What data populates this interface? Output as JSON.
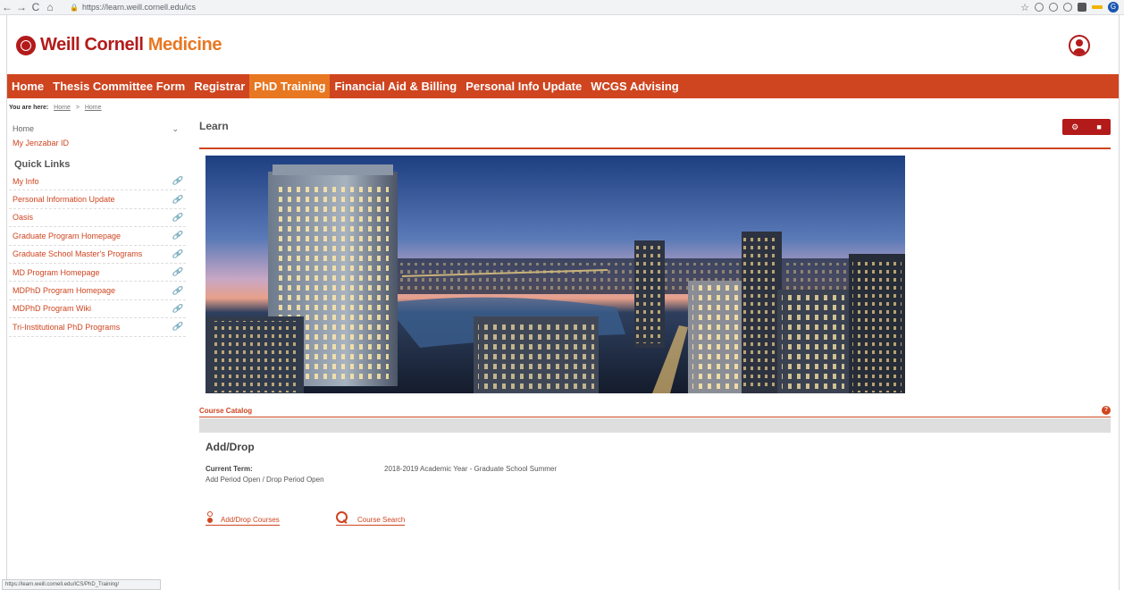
{
  "browser": {
    "url": "https://learn.weill.cornell.edu/ics",
    "back_glyph": "←",
    "forward_glyph": "→",
    "reload_glyph": "C",
    "home_glyph": "⌂",
    "lock_glyph": "🔒",
    "star_glyph": "☆",
    "profile_letter": "G",
    "status_link": "https://learn.weill.cornell.edu/ICS/PhD_Training/"
  },
  "header": {
    "logo_part1": "Weill Cornell ",
    "logo_part2": "Medicine"
  },
  "nav": {
    "items": [
      {
        "label": "Home"
      },
      {
        "label": "Thesis Committee Form"
      },
      {
        "label": "Registrar"
      },
      {
        "label": "PhD Training"
      },
      {
        "label": "Financial Aid & Billing"
      },
      {
        "label": "Personal Info Update"
      },
      {
        "label": "WCGS Advising"
      }
    ],
    "active_index": 3
  },
  "breadcrumb": {
    "label": "You are here:",
    "crumb1": "Home",
    "separator": ">",
    "crumb2": "Home"
  },
  "sidebar": {
    "home_label": "Home",
    "chevron": "⌄",
    "jenzabar_label": "My Jenzabar ID",
    "quick_links_heading": "Quick Links",
    "link_glyph": "🔗",
    "quick_links": [
      "My Info",
      "Personal Information Update",
      "Oasis",
      "Graduate Program Homepage",
      "Graduate School Master's Programs",
      "MD Program Homepage",
      "MDPhD Program Homepage",
      "MDPhD Program Wiki",
      "Tri-Institutional PhD Programs"
    ]
  },
  "content": {
    "title": "Learn",
    "gear_glyph": "⚙",
    "print_glyph": "■",
    "catalog_title": "Course Catalog",
    "help_glyph": "?",
    "adddrop_heading": "Add/Drop",
    "term_label": "Current Term:",
    "term_value": "2018-2019 Academic Year - Graduate School Summer",
    "period_text": "Add Period Open / Drop Period Open",
    "adddrop_courses": "Add/Drop Courses",
    "course_search": "Course Search"
  },
  "colors": {
    "nav_bg": "#cf4520",
    "nav_active": "#e87722",
    "brand_red": "#b31b1b"
  }
}
